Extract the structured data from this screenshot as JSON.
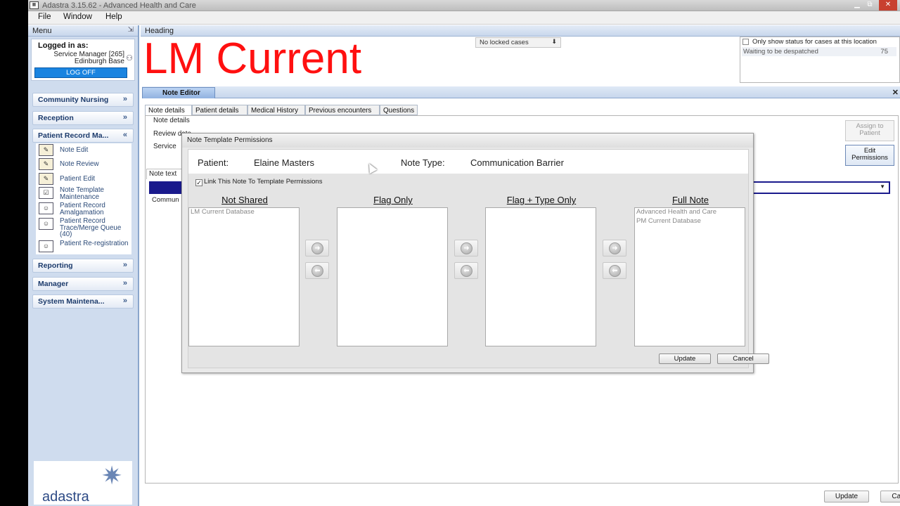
{
  "window": {
    "title": "Adastra 3.15.62 - Advanced Health and Care"
  },
  "menubar": {
    "items": [
      "File",
      "Window",
      "Help"
    ]
  },
  "leftpanel": {
    "header": "Menu",
    "logged_in_label": "Logged in as:",
    "user_line1": "Service Manager [265]",
    "user_line2": "Edinburgh Base",
    "logoff": "LOG OFF",
    "sections": [
      "Community Nursing",
      "Reception",
      "Patient Record Ma...",
      "Reporting",
      "Manager",
      "System Maintena..."
    ],
    "subitems": [
      "Note Edit",
      "Note Review",
      "Patient Edit",
      "Note Template Maintenance",
      "Patient Record Amalgamation",
      "Patient Record Trace/Merge Queue (40)",
      "Patient Re-registration"
    ],
    "logo_text": "adastra"
  },
  "main": {
    "heading_label": "Heading",
    "big_heading": "LM Current",
    "locked_cases": "No locked cases",
    "status_checkbox_label": "Only show status for cases at this location",
    "status_row_label": "Waiting to be despatched",
    "status_row_count": "75",
    "note_editor_tab": "Note Editor",
    "subtabs": [
      "Note details",
      "Patient details",
      "Medical History",
      "Previous encounters",
      "Questions"
    ],
    "field_note_details": "Note details",
    "field_review_date": "Review date",
    "field_service": "Service",
    "assign_button": "Assign to Patient",
    "edit_permissions_button": "Edit Permissions",
    "note_text_label": "Note text",
    "note_type_cell": "Commun",
    "update_button": "Update",
    "cancel_button": "Cancel"
  },
  "dialog": {
    "title": "Note Template Permissions",
    "patient_label": "Patient:",
    "patient_value": "Elaine Masters",
    "note_type_label": "Note Type:",
    "note_type_value": "Communication Barrier",
    "link_checkbox_label": "Link This Note To Template Permissions",
    "columns": [
      {
        "header": "Not Shared",
        "items": [
          "LM Current Database"
        ]
      },
      {
        "header": "Flag Only",
        "items": []
      },
      {
        "header": "Flag + Type Only",
        "items": []
      },
      {
        "header": "Full Note",
        "items": [
          "Advanced Health and Care",
          "PM Current Database"
        ]
      }
    ],
    "update_button": "Update",
    "cancel_button": "Cancel"
  }
}
